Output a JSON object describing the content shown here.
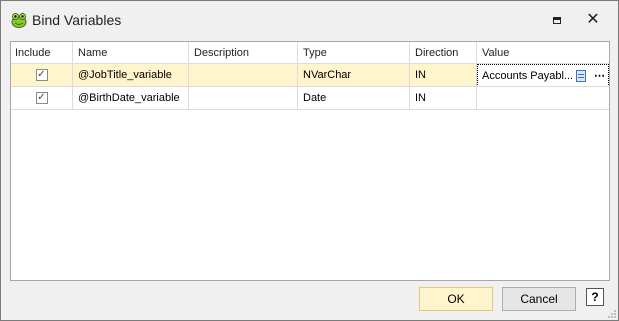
{
  "window": {
    "title": "Bind Variables",
    "icon": "frog-app-icon",
    "controls": [
      "maximize-icon",
      "close-icon"
    ]
  },
  "grid": {
    "columns": [
      "Include",
      "Name",
      "Description",
      "Type",
      "Direction",
      "Value"
    ],
    "rows": [
      {
        "include": true,
        "check_glyph": "✓",
        "name": "@JobTitle_variable",
        "description": "",
        "type": "NVarChar",
        "direction": "IN",
        "value": "Accounts Payabl...",
        "selected": true
      },
      {
        "include": true,
        "check_glyph": "✓",
        "name": "@BirthDate_variable",
        "description": "",
        "type": "Date",
        "direction": "IN",
        "value": "",
        "selected": false
      }
    ],
    "value_editor": {
      "memo_icon": "memo-icon",
      "ellipsis": "⋯"
    }
  },
  "footer": {
    "ok_label": "OK",
    "cancel_label": "Cancel",
    "help_label": "?"
  },
  "colors": {
    "selected_row": "#fff5cc",
    "ok_button": "#fff5cc"
  }
}
